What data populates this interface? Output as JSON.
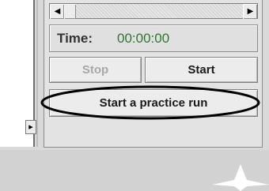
{
  "scrollbar": {
    "left_arrow": "◀",
    "right_arrow": "▶"
  },
  "left_pane": {
    "arrow": "▸"
  },
  "timer": {
    "label": "Time:",
    "value": "00:00:00",
    "value_color": "#2a7a2a"
  },
  "buttons": {
    "stop_label": "Stop",
    "start_label": "Start",
    "practice_label": "Start a practice run"
  },
  "colors": {
    "panel_bg": "#e3e3e3",
    "disabled_text": "#a8a8a8"
  }
}
